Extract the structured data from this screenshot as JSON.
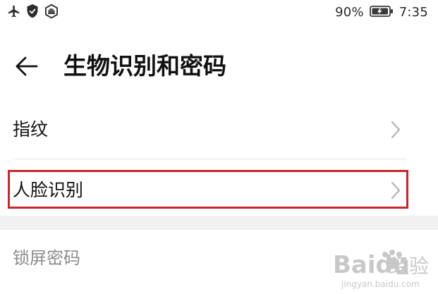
{
  "status_bar": {
    "battery": "90%",
    "time": "7:35",
    "icons": [
      "airplane-icon",
      "shield-check-icon",
      "hand-badge-icon",
      "battery-icon"
    ]
  },
  "header": {
    "title": "生物识别和密码"
  },
  "rows": [
    {
      "label": "指纹"
    },
    {
      "label": "人脸识别"
    }
  ],
  "section": {
    "label": "锁屏密码"
  },
  "watermark": {
    "brand": "Baidu",
    "suffix": "经验",
    "url": "jingyan.baidu.com"
  },
  "colors": {
    "highlight": "#c8262c",
    "divider": "#e6e6e6",
    "section_bg": "#f1f1f1",
    "text": "#111111",
    "muted": "#8b8b8b"
  }
}
